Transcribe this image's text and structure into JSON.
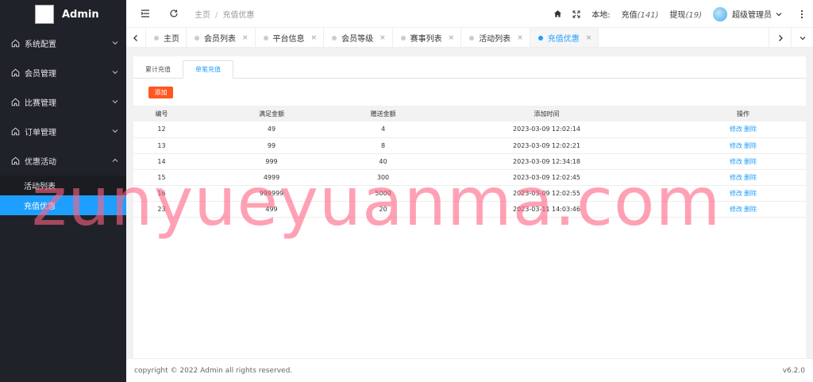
{
  "app": {
    "title": "Admin"
  },
  "sidebar": {
    "items": [
      {
        "label": "系统配置",
        "expanded": false
      },
      {
        "label": "会员管理",
        "expanded": false
      },
      {
        "label": "比赛管理",
        "expanded": false
      },
      {
        "label": "订单管理",
        "expanded": false
      },
      {
        "label": "优惠活动",
        "expanded": true
      }
    ],
    "subitems": [
      {
        "label": "活动列表",
        "active": false
      },
      {
        "label": "充值优惠",
        "active": true
      }
    ]
  },
  "header": {
    "breadcrumb_home": "主页",
    "breadcrumb_sep": "/",
    "breadcrumb_current": "充值优惠",
    "local_label": "本地:",
    "recharge_label": "充值",
    "recharge_count": "(141)",
    "withdraw_label": "提现",
    "withdraw_count": "(19)",
    "username": "超级管理员"
  },
  "tabs": [
    {
      "label": "主页",
      "closable": false,
      "active": false
    },
    {
      "label": "会员列表",
      "closable": true,
      "active": false
    },
    {
      "label": "平台信息",
      "closable": true,
      "active": false
    },
    {
      "label": "会员等级",
      "closable": true,
      "active": false
    },
    {
      "label": "赛事列表",
      "closable": true,
      "active": false
    },
    {
      "label": "活动列表",
      "closable": true,
      "active": false
    },
    {
      "label": "充值优惠",
      "closable": true,
      "active": true
    }
  ],
  "tab_close_glyph": "×",
  "subtabs": [
    {
      "label": "累计充值",
      "active": false
    },
    {
      "label": "单笔充值",
      "active": true
    }
  ],
  "add_button": "添加",
  "table": {
    "headers": [
      "编号",
      "满足金额",
      "赠送金额",
      "添加时间",
      "操作"
    ],
    "rows": [
      {
        "id": "12",
        "min": "49",
        "bonus": "4",
        "time": "2023-03-09 12:02:14"
      },
      {
        "id": "13",
        "min": "99",
        "bonus": "8",
        "time": "2023-03-09 12:02:21"
      },
      {
        "id": "14",
        "min": "999",
        "bonus": "40",
        "time": "2023-03-09 12:34:18"
      },
      {
        "id": "15",
        "min": "4999",
        "bonus": "300",
        "time": "2023-03-09 12:02:45"
      },
      {
        "id": "16",
        "min": "999999",
        "bonus": "5000",
        "time": "2023-03-09 12:02:55"
      },
      {
        "id": "23",
        "min": "499",
        "bonus": "20",
        "time": "2023-03-11 14:03:46"
      }
    ],
    "edit_label": "修改",
    "delete_label": "删除"
  },
  "footer": {
    "copyright": "copyright © 2022 Admin all rights reserved.",
    "version": "v6.2.0"
  },
  "watermark": "zunyueyuanma.com",
  "colors": {
    "accent": "#1e9fff",
    "sidebar_bg": "#20222a",
    "add_button": "#ff5722",
    "watermark": "#ff6382"
  }
}
